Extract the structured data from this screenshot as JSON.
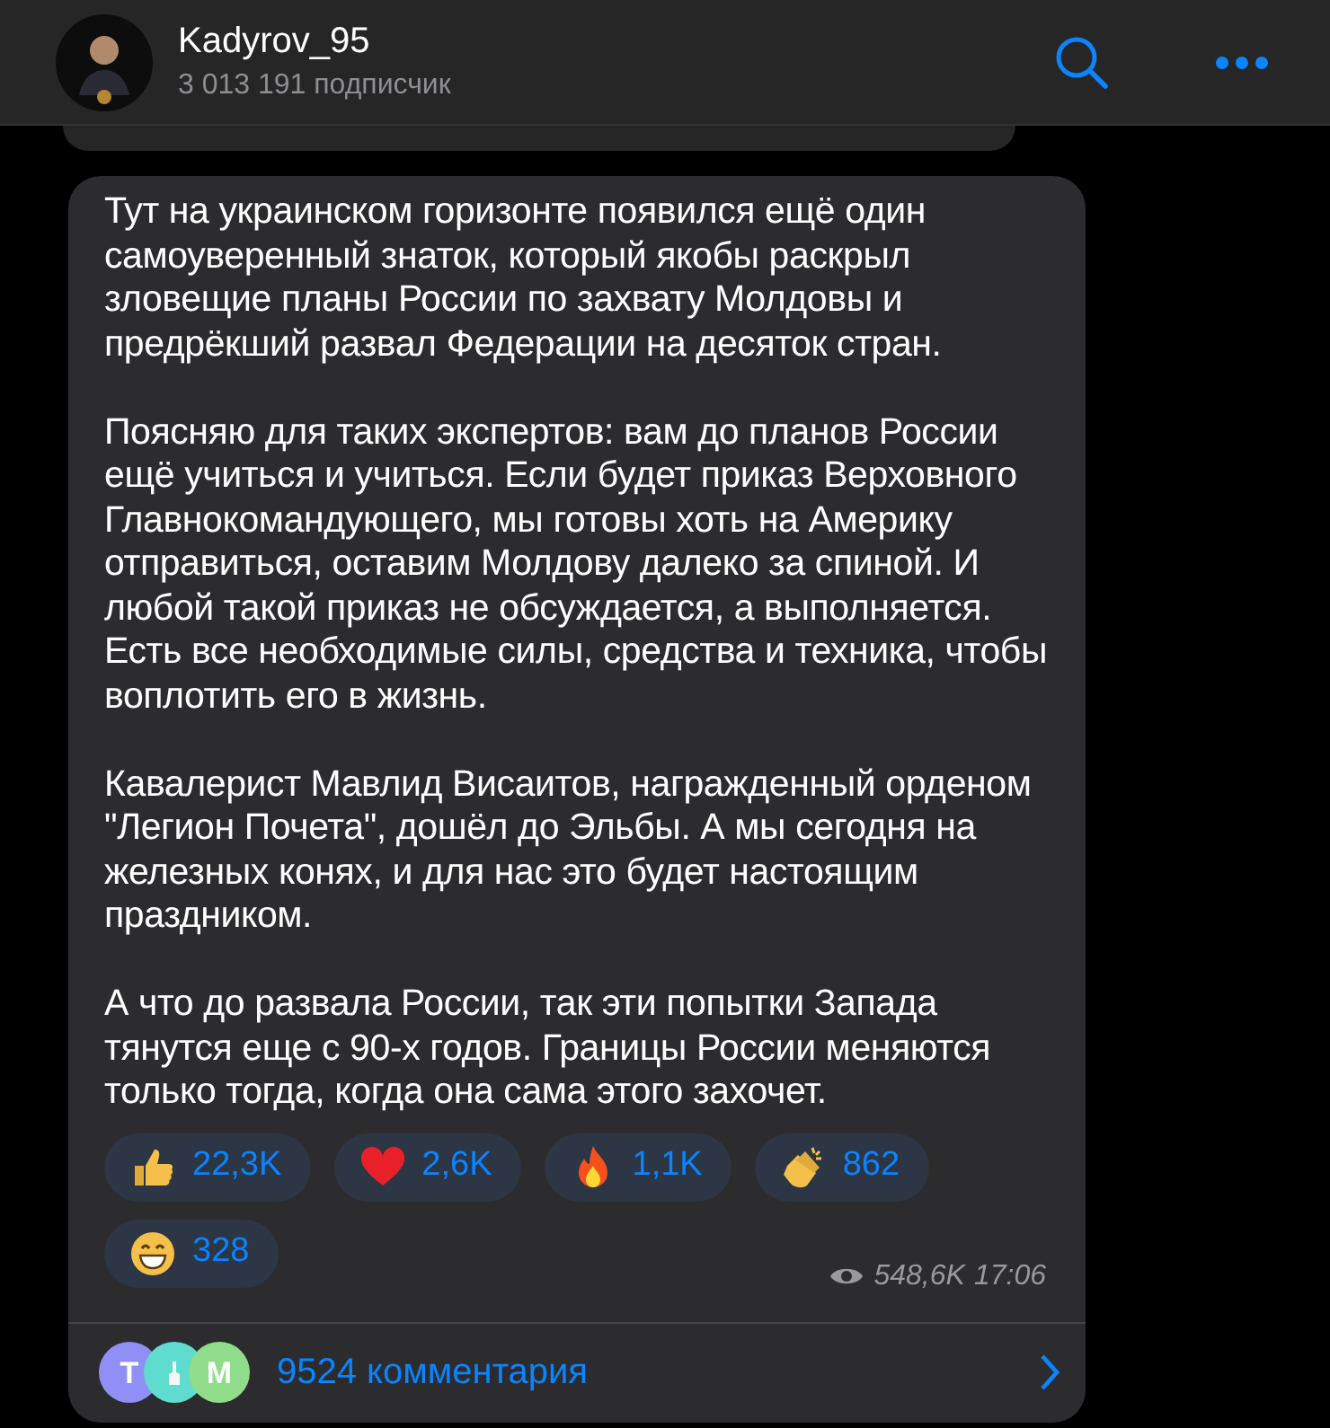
{
  "header": {
    "title": "Kadyrov_95",
    "subtitle": "3 013 191 подписчик"
  },
  "post": {
    "paragraphs": [
      "Тут на украинском горизонте появился ещё один самоуверенный знаток, который якобы раскрыл зловещие планы России по захвату Молдовы и предрёкший развал Федерации на десяток стран.",
      "Поясняю для таких экспертов: вам до планов России ещё учиться и учиться. Если будет приказ Верховного Главнокомандующего, мы готовы хоть на Америку отправиться, оставим Молдову далеко за спиной. И любой такой приказ не обсуждается, а выполняется. Есть все необходимые силы, средства и техника, чтобы воплотить его в жизнь.",
      "Кавалерист Мавлид Висаитов, награжденный орденом \"Легион Почета\", дошёл до Эльбы. А мы сегодня на железных конях, и для нас это будет настоящим праздником.",
      "А что до развала России, так эти попытки Запада тянутся еще с 90-х годов. Границы России меняются только тогда, когда она сама этого захочет."
    ],
    "reactions": [
      {
        "kind": "thumbs",
        "count": "22,3K"
      },
      {
        "kind": "heart",
        "count": "2,6K"
      },
      {
        "kind": "fire",
        "count": "1,1K"
      },
      {
        "kind": "clap",
        "count": "862"
      },
      {
        "kind": "grin",
        "count": "328"
      }
    ],
    "views": "548,6K",
    "time": "17:06",
    "comments": {
      "avatars": [
        {
          "kind": "letter",
          "letter": "Т",
          "color": "#8f8ff5"
        },
        {
          "kind": "picture",
          "color": "#5fdccf"
        },
        {
          "kind": "letter",
          "letter": "М",
          "color": "#8fdc8a"
        }
      ],
      "label": "9524 комментария"
    }
  }
}
